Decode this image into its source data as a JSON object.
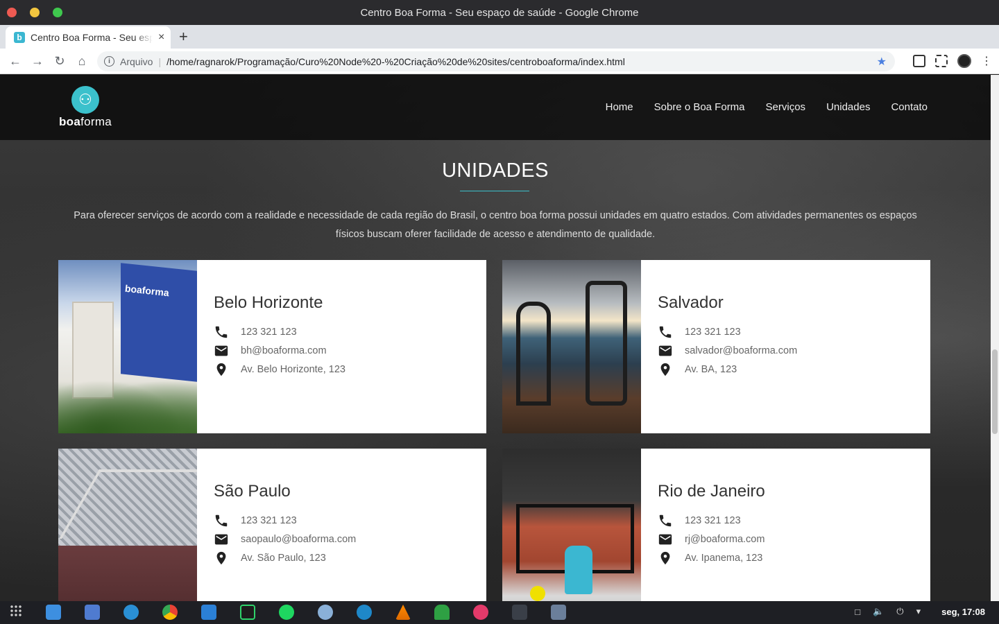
{
  "window": {
    "title": "Centro Boa Forma - Seu espaço de saúde - Google Chrome"
  },
  "browser": {
    "tab_title": "Centro Boa Forma - Seu espaço de saúde",
    "tab_favicon": "b",
    "tab_close": "×",
    "new_tab": "+",
    "security_label": "Arquivo",
    "url": "/home/ragnarok/Programação/Curo%20Node%20-%20Criação%20de%20sites/centroboaforma/index.html"
  },
  "site": {
    "logo_bold": "boa",
    "logo_rest": "forma",
    "menu": [
      "Home",
      "Sobre o Boa Forma",
      "Serviços",
      "Unidades",
      "Contato"
    ]
  },
  "section": {
    "title": "UNIDADES",
    "intro": "Para oferecer serviços de acordo com a realidade e necessidade de cada região do Brasil, o centro boa forma possui unidades em quatro estados. Com atividades permanentes os espaços físicos buscam oferer facilidade de acesso e atendimento de qualidade."
  },
  "units": [
    {
      "city": "Belo Horizonte",
      "phone": "123 321 123",
      "email": "bh@boaforma.com",
      "address": "Av. Belo Horizonte, 123",
      "image_brand": "boaforma"
    },
    {
      "city": "Salvador",
      "phone": "123 321 123",
      "email": "salvador@boaforma.com",
      "address": "Av. BA, 123"
    },
    {
      "city": "São Paulo",
      "phone": "123 321 123",
      "email": "saopaulo@boaforma.com",
      "address": "Av. São Paulo, 123"
    },
    {
      "city": "Rio de Janeiro",
      "phone": "123 321 123",
      "email": "rj@boaforma.com",
      "address": "Av. Ipanema, 123"
    }
  ],
  "taskbar": {
    "clock": "seg, 17:08"
  },
  "colors": {
    "accent": "#3bc1cc",
    "header_bg": "#0a0a0a",
    "card_bg": "#ffffff"
  },
  "icons": [
    "phone-icon",
    "email-icon",
    "location-pin-icon"
  ]
}
